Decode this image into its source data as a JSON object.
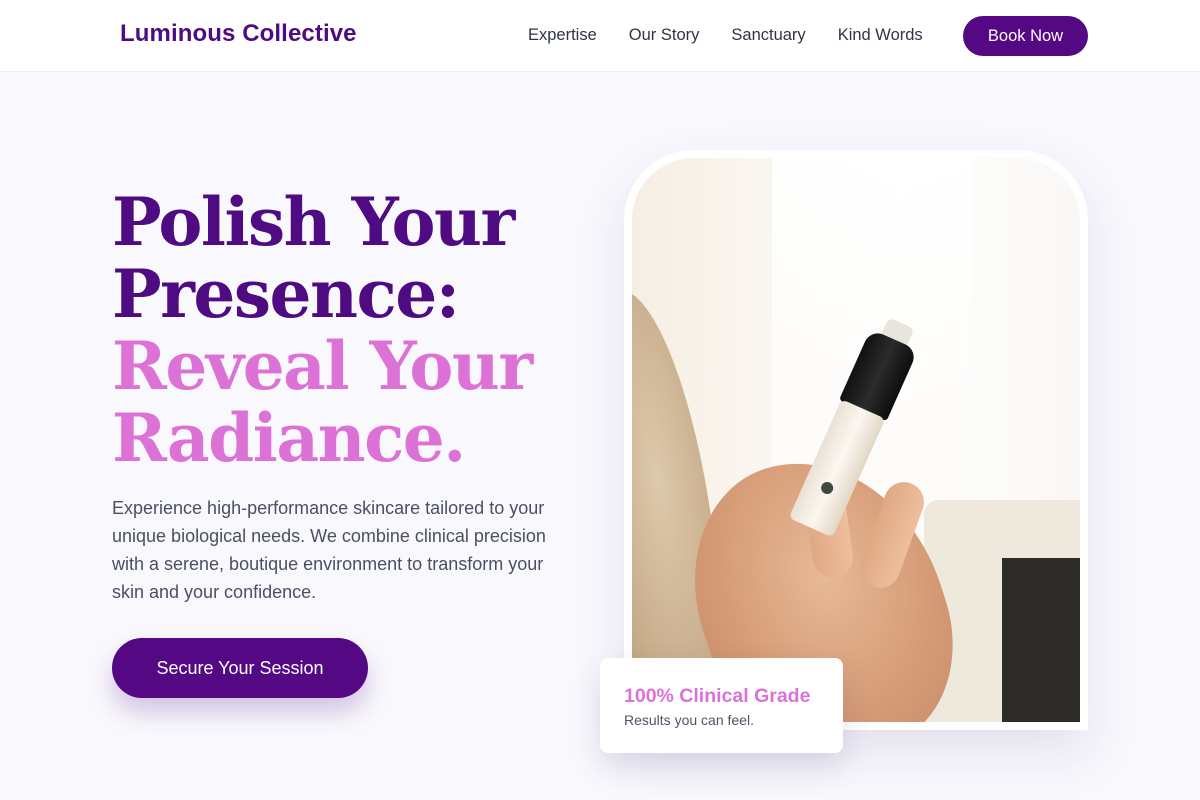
{
  "nav": {
    "brand": "Luminous Collective",
    "links": [
      "Expertise",
      "Our Story",
      "Sanctuary",
      "Kind Words"
    ],
    "cta": "Book Now"
  },
  "hero": {
    "headline_line1": "Polish Your",
    "headline_line2": "Presence:",
    "headline_line3": "Reveal Your",
    "headline_line4": "Radiance.",
    "description": "Experience high-performance skincare tailored to your unique biological needs. We combine clinical precision with a serene, boutique environment to transform your skin and your confidence.",
    "cta": "Secure Your Session"
  },
  "badge": {
    "title": "100% Clinical Grade",
    "subtitle": "Results you can feel."
  },
  "colors": {
    "primary": "#540884",
    "accent_pink": "#dd72d6",
    "background": "#f9f8fd"
  }
}
